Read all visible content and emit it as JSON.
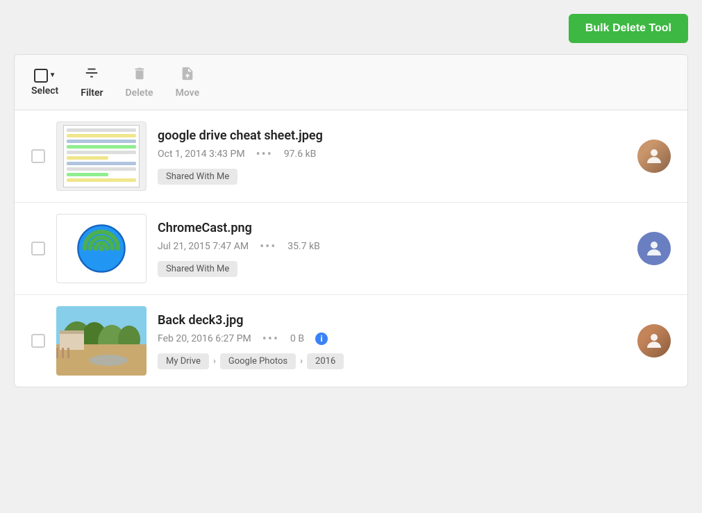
{
  "topbar": {
    "bulk_delete_label": "Bulk Delete Tool"
  },
  "toolbar": {
    "select_label": "Select",
    "filter_label": "Filter",
    "delete_label": "Delete",
    "move_label": "Move"
  },
  "files": [
    {
      "id": "file-1",
      "name": "google drive cheat sheet.jpeg",
      "date": "Oct 1, 2014 3:43 PM",
      "size": "97.6 kB",
      "tag": "Shared With Me",
      "tag_type": "shared",
      "thumb_type": "doc",
      "avatar_type": "woman"
    },
    {
      "id": "file-2",
      "name": "ChromeCast.png",
      "date": "Jul 21, 2015 7:47 AM",
      "size": "35.7 kB",
      "tag": "Shared With Me",
      "tag_type": "shared",
      "thumb_type": "chromecast",
      "avatar_type": "generic"
    },
    {
      "id": "file-3",
      "name": "Back deck3.jpg",
      "date": "Feb 20, 2016 6:27 PM",
      "size": "0 B",
      "tag_type": "breadcrumb",
      "breadcrumb": [
        "My Drive",
        "Google Photos",
        "2016"
      ],
      "thumb_type": "outdoor",
      "avatar_type": "man",
      "has_info": true
    }
  ]
}
